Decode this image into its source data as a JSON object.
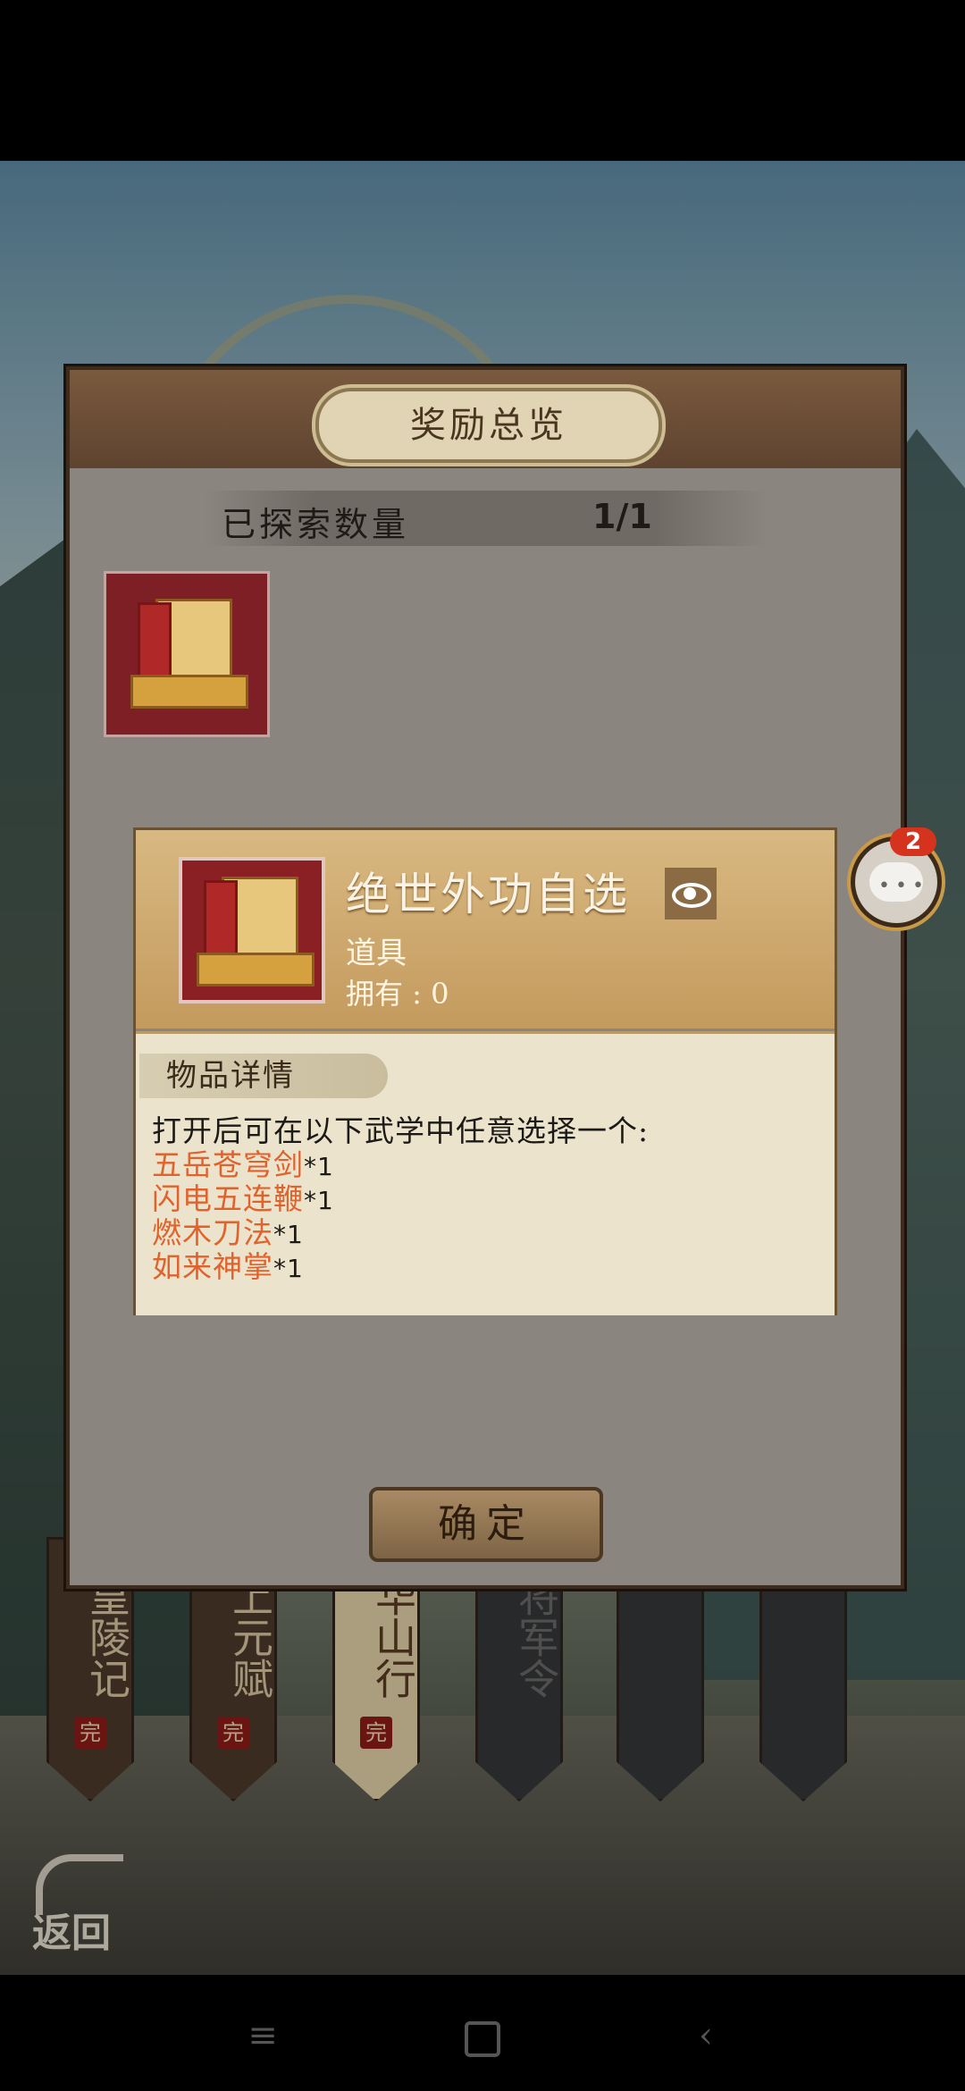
{
  "dialog": {
    "title": "奖励总览",
    "explore_label": "已探索数量",
    "explore_value": "1/1",
    "confirm_label": "确定"
  },
  "item_popup": {
    "name": "绝世外功自选",
    "type": "道具",
    "owned": "拥有 : 0",
    "detail_tab": "物品详情",
    "description": "打开后可在以下武学中任意选择一个:",
    "rewards": [
      {
        "name": "五岳苍穹剑",
        "qty": "*1"
      },
      {
        "name": "闪电五连鞭",
        "qty": "*1"
      },
      {
        "name": "燃木刀法",
        "qty": "*1"
      },
      {
        "name": "如来神掌",
        "qty": "*1"
      }
    ]
  },
  "banners": [
    {
      "label": "皇陵记",
      "badge": "完"
    },
    {
      "label": "上元赋",
      "badge": "完"
    },
    {
      "label": "华山行",
      "badge": "完"
    },
    {
      "label": "将军令",
      "badge": ""
    },
    {
      "label": "",
      "badge": ""
    },
    {
      "label": "",
      "badge": ""
    }
  ],
  "chat": {
    "badge_count": "2"
  },
  "return_label": "返回",
  "colors": {
    "reward_name": "#e0622c",
    "badge": "#d6331e"
  },
  "icons": [
    "eye-icon",
    "chat-icon",
    "return-arrow-icon",
    "menu-icon",
    "home-icon",
    "back-icon"
  ]
}
